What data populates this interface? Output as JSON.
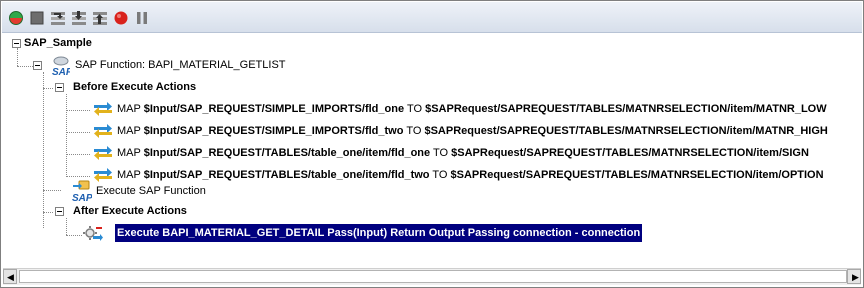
{
  "toolbar": {
    "buttons": [
      "play-icon",
      "stop-square-icon",
      "step-over-icon",
      "step-into-icon",
      "step-out-icon",
      "breakpoint-icon",
      "pause-icon"
    ]
  },
  "tree": {
    "root": "SAP_Sample",
    "function": {
      "label": "SAP Function: BAPI_MATERIAL_GETLIST",
      "icon_text": "SAP"
    },
    "before": {
      "label": "Before Execute Actions",
      "items": [
        {
          "kw": "MAP",
          "src": "$Input/SAP_REQUEST/SIMPLE_IMPORTS/fld_one",
          "to": "TO",
          "dst": "$SAPRequest/SAPREQUEST/TABLES/MATNRSELECTION/item/MATNR_LOW"
        },
        {
          "kw": "MAP",
          "src": "$Input/SAP_REQUEST/SIMPLE_IMPORTS/fld_two",
          "to": "TO",
          "dst": "$SAPRequest/SAPREQUEST/TABLES/MATNRSELECTION/item/MATNR_HIGH"
        },
        {
          "kw": "MAP",
          "src": "$Input/SAP_REQUEST/TABLES/table_one/item/fld_one",
          "to": "TO",
          "dst": "$SAPRequest/SAPREQUEST/TABLES/MATNRSELECTION/item/SIGN"
        },
        {
          "kw": "MAP",
          "src": "$Input/SAP_REQUEST/TABLES/table_one/item/fld_two",
          "to": "TO",
          "dst": "$SAPRequest/SAPREQUEST/TABLES/MATNRSELECTION/item/OPTION"
        }
      ]
    },
    "execute": {
      "label": "Execute SAP Function",
      "icon_text": "SAP"
    },
    "after": {
      "label": "After Execute Actions",
      "selected_item": "Execute BAPI_MATERIAL_GET_DETAIL Pass(Input) Return Output Passing connection - connection"
    }
  },
  "colors": {
    "selection_bg": "#00007f",
    "toolbar_bg": "#dfe5ef"
  }
}
